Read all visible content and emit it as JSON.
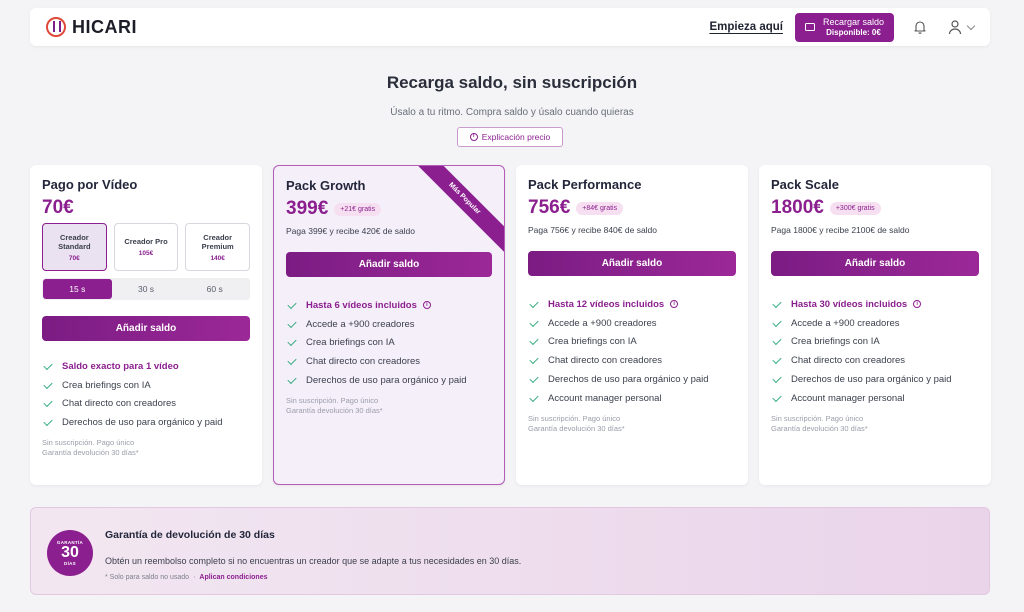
{
  "nav": {
    "logo": "HICARI",
    "start_link": "Empieza aquí",
    "recharge": {
      "title": "Recargar saldo",
      "balance": "Disponible: 0€"
    }
  },
  "hero": {
    "title": "Recarga saldo, sin suscripción",
    "subtitle": "Úsalo a tu ritmo. Compra saldo y úsalo cuando quieras",
    "explain_button": "Explicación precio"
  },
  "cards": {
    "pay_per_video": {
      "title": "Pago por Vídeo",
      "price": "70€",
      "creators": [
        {
          "name": "Creador Standard",
          "price": "70€",
          "selected": true
        },
        {
          "name": "Creador Pro",
          "price": "105€",
          "selected": false
        },
        {
          "name": "Creador Premium",
          "price": "140€",
          "selected": false
        }
      ],
      "durations": [
        "15 s",
        "30 s",
        "60 s"
      ],
      "active_duration": "15 s",
      "button": "Añadir saldo",
      "features": [
        "Saldo exacto para 1 vídeo",
        "Crea briefings con IA",
        "Chat directo con creadores",
        "Derechos de uso para orgánico y paid"
      ],
      "note1": "Sin suscripción. Pago único",
      "note2": "Garantía devolución 30 días*"
    },
    "growth": {
      "title": "Pack Growth",
      "ribbon": "Más Popular",
      "price": "399€",
      "bonus": "+21€ gratis",
      "detail": "Paga 399€ y recibe 420€ de saldo",
      "button": "Añadir saldo",
      "features": [
        "Hasta 6 vídeos incluidos",
        "Accede a +900 creadores",
        "Crea briefings con IA",
        "Chat directo con creadores",
        "Derechos de uso para orgánico y paid"
      ],
      "note1": "Sin suscripción. Pago único",
      "note2": "Garantía devolución 30 días*"
    },
    "performance": {
      "title": "Pack Performance",
      "price": "756€",
      "bonus": "+84€ gratis",
      "detail": "Paga 756€ y recibe 840€ de saldo",
      "button": "Añadir saldo",
      "features": [
        "Hasta 12 vídeos incluidos",
        "Accede a +900 creadores",
        "Crea briefings con IA",
        "Chat directo con creadores",
        "Derechos de uso para orgánico y paid",
        "Account manager personal"
      ],
      "note1": "Sin suscripción. Pago único",
      "note2": "Garantía devolución 30 días*"
    },
    "scale": {
      "title": "Pack Scale",
      "price": "1800€",
      "bonus": "+300€ gratis",
      "detail": "Paga 1800€ y recibe 2100€ de saldo",
      "button": "Añadir saldo",
      "features": [
        "Hasta 30 vídeos incluidos",
        "Accede a +900 creadores",
        "Crea briefings con IA",
        "Chat directo con creadores",
        "Derechos de uso para orgánico y paid",
        "Account manager personal"
      ],
      "note1": "Sin suscripción. Pago único",
      "note2": "Garantía devolución 30 días*"
    }
  },
  "guarantee": {
    "badge_top": "GARANTÍA",
    "badge_number": "30",
    "badge_bottom": "DÍAS",
    "title": "Garantía de devolución de 30 días",
    "description": "Obtén un reembolso completo si no encuentras un creador que se adapte a tus necesidades en 30 días.",
    "footnote": "* Solo para saldo no usado",
    "separator": "·",
    "conditions_link": "Aplican condiciones"
  },
  "colors": {
    "brand": "#8b1f8f",
    "check": "#3cae83"
  },
  "icons": [
    "wallet-icon",
    "bell-icon",
    "user-icon",
    "info-icon",
    "check-icon"
  ]
}
